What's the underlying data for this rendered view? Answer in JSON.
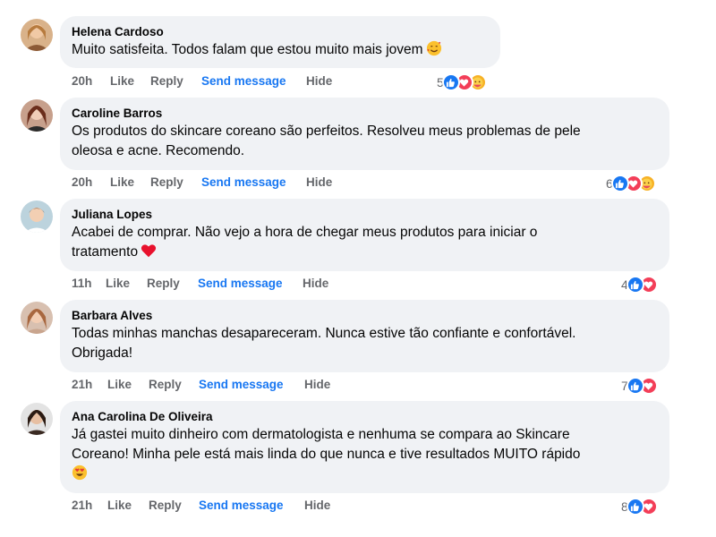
{
  "comments": [
    {
      "author": "Helena Cardoso",
      "lines": [
        "Muito satisfeita. Todos falam que estou muito mais jovem"
      ],
      "time": "20h",
      "like": "Like",
      "reply": "Reply",
      "send": "Send message",
      "hide": "Hide",
      "count": "5",
      "reactions": [
        "like-reaction",
        "love-reaction",
        "care-reaction"
      ],
      "emoji": "smiling-face-with-hearts"
    },
    {
      "author": "Caroline Barros",
      "lines": [
        "Os produtos do skincare coreano são perfeitos. Resolveu meus problemas de pele",
        "oleosa e acne. Recomendo."
      ],
      "time": "20h",
      "like": "Like",
      "reply": "Reply",
      "send": "Send message",
      "hide": "Hide",
      "count": "6",
      "reactions": [
        "like-reaction",
        "love-reaction",
        "care-reaction"
      ]
    },
    {
      "author": "Juliana Lopes",
      "lines": [
        "Acabei de comprar. Não vejo a hora de chegar meus produtos para iniciar o",
        "tratamento"
      ],
      "time": "11h",
      "like": "Like",
      "reply": "Reply",
      "send": "Send message",
      "hide": "Hide",
      "count": "4",
      "reactions": [
        "like-reaction",
        "love-reaction"
      ],
      "emoji": "red-heart"
    },
    {
      "author": "Barbara Alves",
      "lines": [
        "Todas minhas manchas desapareceram. Nunca estive tão confiante e confortável.",
        "Obrigada!"
      ],
      "time": "21h",
      "like": "Like",
      "reply": "Reply",
      "send": "Send message",
      "hide": "Hide",
      "count": "7",
      "reactions": [
        "like-reaction",
        "love-reaction"
      ]
    },
    {
      "author": "Ana Carolina De Oliveira",
      "lines": [
        "Já gastei muito dinheiro com dermatologista e nenhuma se compara ao Skincare",
        "Coreano! Minha pele está mais linda do que nunca e tive resultados MUITO rápido"
      ],
      "time": "21h",
      "like": "Like",
      "reply": "Reply",
      "send": "Send message",
      "hide": "Hide",
      "count": "8",
      "reactions": [
        "like-reaction",
        "love-reaction"
      ],
      "emoji": "heart-eyes-face"
    }
  ],
  "colors": {
    "bubble": "#f0f2f5",
    "link": "#1877f2",
    "meta": "#65676b",
    "like": "#1877f2",
    "love": "#f33e58",
    "care": "#f7b125"
  }
}
